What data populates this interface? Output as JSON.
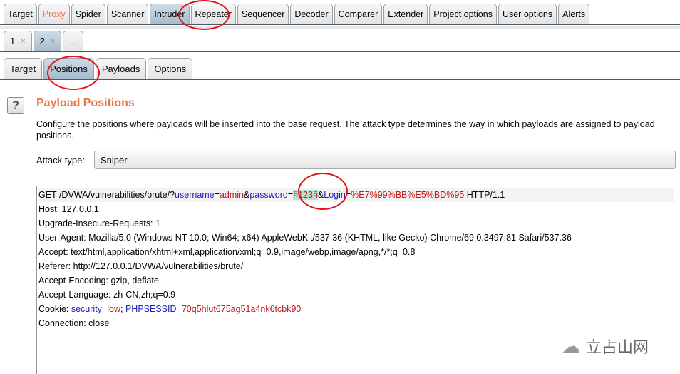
{
  "main_tabs": [
    "Target",
    "Proxy",
    "Spider",
    "Scanner",
    "Intruder",
    "Repeater",
    "Sequencer",
    "Decoder",
    "Comparer",
    "Extender",
    "Project options",
    "User options",
    "Alerts"
  ],
  "main_selected": "Intruder",
  "attack_tabs": [
    {
      "label": "1",
      "close": "×"
    },
    {
      "label": "2",
      "close": "×"
    },
    {
      "label": "..."
    }
  ],
  "sub_tabs": [
    "Target",
    "Positions",
    "Payloads",
    "Options"
  ],
  "help_icon": "?",
  "title": "Payload Positions",
  "description": "Configure the positions where payloads will be inserted into the base request. The attack type determines the way in which payloads are assigned to payload positions.",
  "attack_type_label": "Attack type:",
  "attack_type_value": "Sniper",
  "request": {
    "l1": {
      "a": "GET /DVWA/vulnerabilities/brute/?",
      "k1": "username",
      "e1": "=",
      "v1": "admin",
      "s1": "&",
      "k2": "password",
      "e2": "=",
      "payload": "§123§",
      "s2": "&",
      "k3": "Login",
      "e3": "=",
      "v3": "%E7%99%BB%E5%BD%95",
      "tail": " HTTP/1.1"
    },
    "lines": [
      "Host: 127.0.0.1",
      "Upgrade-Insecure-Requests: 1",
      "User-Agent: Mozilla/5.0 (Windows NT 10.0; Win64; x64) AppleWebKit/537.36 (KHTML, like Gecko) Chrome/69.0.3497.81 Safari/537.36",
      "Accept: text/html,application/xhtml+xml,application/xml;q=0.9,image/webp,image/apng,*/*;q=0.8",
      "Referer: http://127.0.0.1/DVWA/vulnerabilities/brute/",
      "Accept-Encoding: gzip, deflate",
      "Accept-Language: zh-CN,zh;q=0.9"
    ],
    "cookie": {
      "a": "Cookie: ",
      "k1": "security",
      "e1": "=",
      "v1": "low",
      "s": "; ",
      "k2": "PHPSESSID",
      "e2": "=",
      "v2": "70q5hlut675ag51a4nk6tcbk90"
    },
    "last": "Connection: close"
  },
  "watermark": "立占山网",
  "colors": {
    "accent": "#e8784a",
    "annotation": "#e0141a",
    "param": "#1d1db8",
    "value": "#c41a1a",
    "payload_bg": "#b9e4d3"
  }
}
